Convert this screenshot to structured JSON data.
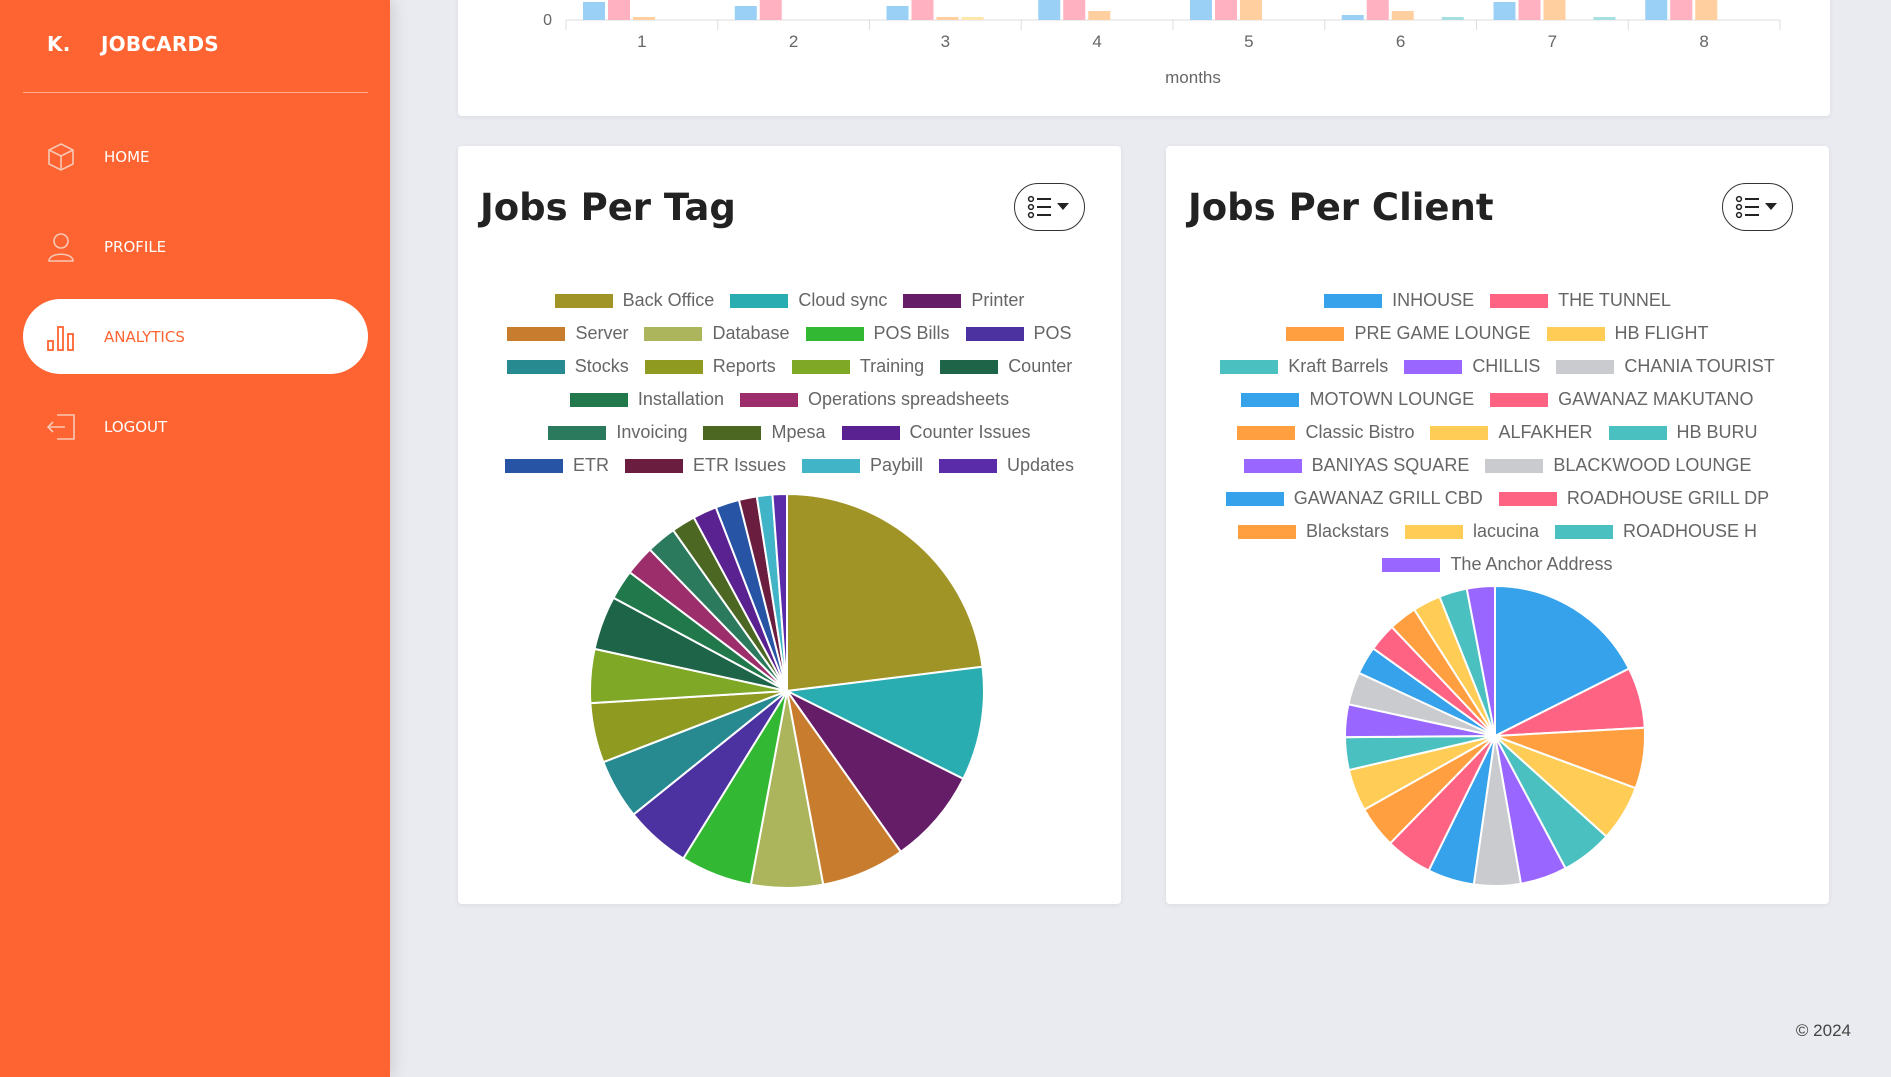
{
  "brand": {
    "logo": "K.",
    "name": "JOBCARDS"
  },
  "nav": [
    {
      "label": "HOME",
      "icon": "cube-icon",
      "active": false
    },
    {
      "label": "PROFILE",
      "icon": "user-icon",
      "active": false
    },
    {
      "label": "ANALYTICS",
      "icon": "bar-chart-icon",
      "active": true
    },
    {
      "label": "LOGOUT",
      "icon": "logout-icon",
      "active": false
    }
  ],
  "colors": {
    "accent": "#fd6431",
    "background": "#e9ebf0"
  },
  "monthly_chart": {
    "type": "bar",
    "xlabel": "months",
    "y_tick_visible": "0",
    "categories": [
      "1",
      "2",
      "3",
      "4",
      "5",
      "6",
      "7",
      "8"
    ],
    "series_colors": [
      "#9ad0f5",
      "#ffb1c1",
      "#ffcf9f",
      "#ffe6aa",
      "#a5dfdf"
    ],
    "values_note_visible_tops": [
      [
        18,
        26,
        3,
        0,
        0
      ],
      [
        14,
        26,
        0,
        0,
        0
      ],
      [
        14,
        24,
        3,
        3,
        0
      ],
      [
        26,
        26,
        9,
        0,
        0
      ],
      [
        26,
        26,
        21,
        0,
        0
      ],
      [
        5,
        26,
        9,
        0,
        3
      ],
      [
        18,
        26,
        26,
        0,
        3
      ],
      [
        26,
        26,
        26,
        0,
        0
      ]
    ]
  },
  "tag_chart": {
    "title": "Jobs Per Tag",
    "chart_data": {
      "type": "pie",
      "legend_rows": [
        [
          "Back Office",
          "Cloud sync",
          "Printer"
        ],
        [
          "Server",
          "Database",
          "POS Bills",
          "POS"
        ],
        [
          "Stocks",
          "Reports",
          "Training",
          "Counter"
        ],
        [
          "Installation",
          "Operations spreadsheets"
        ],
        [
          "Invoicing",
          "Mpesa",
          "Counter Issues"
        ],
        [
          "ETR",
          "ETR Issues",
          "Paybill",
          "Updates"
        ]
      ],
      "labels": [
        "Back Office",
        "Cloud sync",
        "Printer",
        "Server",
        "Database",
        "POS Bills",
        "POS",
        "Stocks",
        "Reports",
        "Training",
        "Counter",
        "Installation",
        "Operations spreadsheets",
        "Invoicing",
        "Mpesa",
        "Counter Issues",
        "ETR",
        "ETR Issues",
        "Paybill",
        "Updates"
      ],
      "values": [
        23.5,
        9.5,
        8.0,
        7.0,
        6.0,
        6.0,
        5.5,
        5.0,
        5.0,
        4.5,
        4.5,
        2.5,
        2.5,
        2.5,
        2.0,
        2.0,
        2.0,
        1.5,
        1.3,
        1.2
      ],
      "colors": [
        "#a09426",
        "#2aadb0",
        "#651d67",
        "#c87d2e",
        "#acb55b",
        "#32b832",
        "#4b32a0",
        "#288a91",
        "#8f9a20",
        "#80a827",
        "#1e6448",
        "#21784a",
        "#9c2e6c",
        "#2c7a5d",
        "#4c6722",
        "#5a2191",
        "#2854a6",
        "#6b1d3f",
        "#41b4c8",
        "#5a2caa"
      ]
    }
  },
  "client_chart": {
    "title": "Jobs Per Client",
    "chart_data": {
      "type": "pie",
      "legend_rows": [
        [
          "INHOUSE",
          "THE TUNNEL"
        ],
        [
          "PRE GAME LOUNGE",
          "HB FLIGHT"
        ],
        [
          "Kraft Barrels",
          "CHILLIS",
          "CHANIA TOURIST"
        ],
        [
          "MOTOWN LOUNGE",
          "GAWANAZ MAKUTANO"
        ],
        [
          "Classic Bistro",
          "ALFAKHER",
          "HB BURU"
        ],
        [
          "BANIYAS SQUARE",
          "BLACKWOOD LOUNGE"
        ],
        [
          "GAWANAZ GRILL CBD",
          "ROADHOUSE GRILL DP"
        ],
        [
          "Blackstars",
          "lacucina",
          "ROADHOUSE H"
        ],
        [
          "The Anchor Address"
        ]
      ],
      "labels": [
        "INHOUSE",
        "THE TUNNEL",
        "PRE GAME LOUNGE",
        "HB FLIGHT",
        "Kraft Barrels",
        "CHILLIS",
        "CHANIA TOURIST",
        "MOTOWN LOUNGE",
        "GAWANAZ MAKUTANO",
        "Classic Bistro",
        "ALFAKHER",
        "HB BURU",
        "BANIYAS SQUARE",
        "BLACKWOOD LOUNGE",
        "GAWANAZ GRILL CBD",
        "ROADHOUSE GRILL DP",
        "Blackstars",
        "lacucina",
        "ROADHOUSE H",
        "The Anchor Address"
      ],
      "values": [
        17.5,
        6.5,
        6.5,
        6.0,
        5.5,
        5.0,
        5.0,
        5.0,
        5.0,
        4.5,
        4.5,
        3.5,
        3.5,
        3.5,
        3.0,
        3.0,
        3.0,
        3.0,
        3.0,
        3.0
      ],
      "colors": [
        "#36a2eb",
        "#ff6384",
        "#ff9f40",
        "#ffcd56",
        "#4bc0c0",
        "#9966ff",
        "#c9cbcf",
        "#36a2eb",
        "#ff6384",
        "#ff9f40",
        "#ffcd56",
        "#4bc0c0",
        "#9966ff",
        "#c9cbcf",
        "#36a2eb",
        "#ff6384",
        "#ff9f40",
        "#ffcd56",
        "#4bc0c0",
        "#9966ff"
      ]
    }
  },
  "footer": {
    "copyright": "© 2024"
  }
}
